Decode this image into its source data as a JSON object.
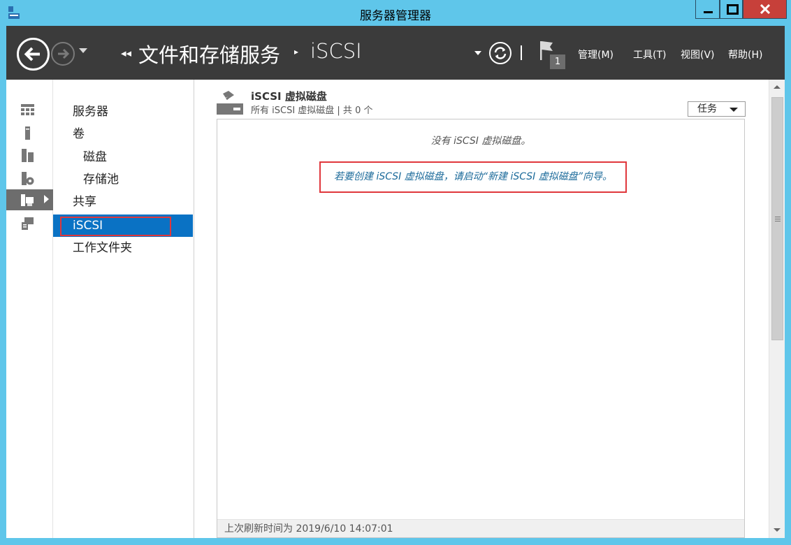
{
  "window": {
    "title": "服务器管理器"
  },
  "header": {
    "breadcrumb_prefix": "◂◂",
    "breadcrumb_main": "文件和存储服务",
    "breadcrumb_sep": "▸",
    "breadcrumb_current": "iSCSI",
    "flag_count": "1",
    "menus": {
      "manage": "管理(M)",
      "tools": "工具(T)",
      "view": "视图(V)",
      "help": "帮助(H)"
    }
  },
  "rail": {
    "icons": [
      "dashboard-icon",
      "local-server-icon",
      "all-servers-icon",
      "roles-icon",
      "file-storage-icon",
      "remote-desktop-icon"
    ]
  },
  "nav": {
    "items": [
      {
        "label": "服务器",
        "sub": false
      },
      {
        "label": "卷",
        "sub": false
      },
      {
        "label": "磁盘",
        "sub": true
      },
      {
        "label": "存储池",
        "sub": true
      },
      {
        "label": "共享",
        "sub": false
      },
      {
        "label": "iSCSI",
        "sub": false,
        "selected": true
      },
      {
        "label": "工作文件夹",
        "sub": false
      }
    ]
  },
  "section": {
    "title": "iSCSI 虚拟磁盘",
    "subtitle": "所有 iSCSI 虚拟磁盘 | 共 0 个",
    "tasks_label": "任务",
    "empty_message": "没有 iSCSI 虚拟磁盘。",
    "wizard_link": "若要创建 iSCSI 虚拟磁盘，请启动“新建 iSCSI 虚拟磁盘”向导。",
    "status": "上次刷新时间为 2019/6/10 14:07:01"
  },
  "colors": {
    "titlebar": "#5fc6ea",
    "header": "#3b3b3b",
    "selected": "#0a72c4",
    "highlight": "#e0373c"
  }
}
